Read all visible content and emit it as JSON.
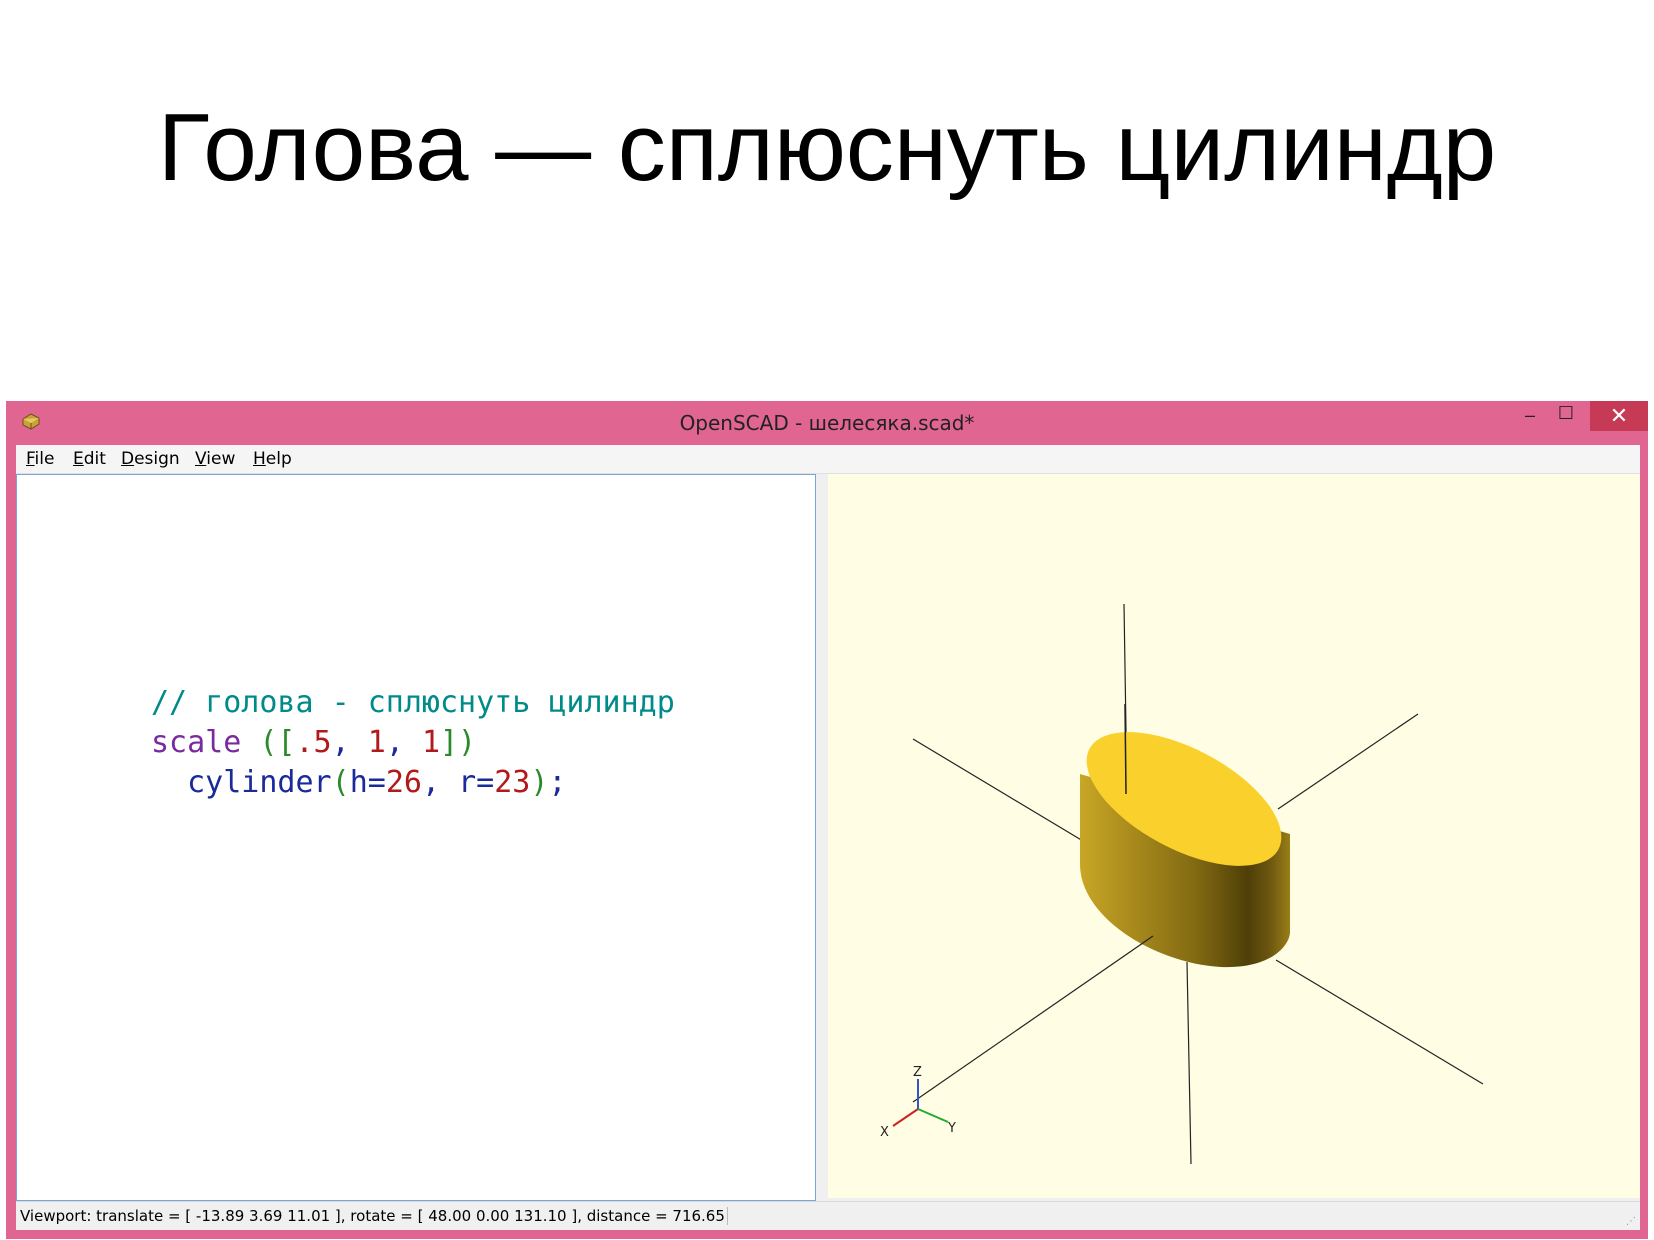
{
  "slide": {
    "title": "Голова — сплюснуть цилиндр"
  },
  "window": {
    "title": "OpenSCAD - шелесяка.scad*",
    "controls": {
      "minimize": "–",
      "maximize": "☐",
      "close": "✕"
    },
    "app_icon": "openscad-logo-icon"
  },
  "menu": {
    "items": [
      {
        "mnemonic": "F",
        "rest": "ile"
      },
      {
        "mnemonic": "E",
        "rest": "dit"
      },
      {
        "mnemonic": "D",
        "rest": "esign"
      },
      {
        "mnemonic": "V",
        "rest": "iew"
      },
      {
        "mnemonic": "H",
        "rest": "elp"
      }
    ]
  },
  "editor": {
    "line1": {
      "comment": "// голова - сплюснуть цилиндр"
    },
    "line2": {
      "keyword": "scale",
      "space": " ",
      "open": "([",
      "n1": ".5",
      "sep1": ", ",
      "n2": "1",
      "sep2": ", ",
      "n3": "1",
      "close": "])"
    },
    "line3": {
      "indent": "  ",
      "module": "cylinder",
      "open": "(",
      "p1": "h=",
      "v1": "26",
      "sep": ", ",
      "p2": "r=",
      "v2": "23",
      "close": ")",
      "end": ";"
    }
  },
  "viewer": {
    "background": "#fffee4",
    "model_color": "#f9d02c",
    "axes_labels": {
      "z": "Z",
      "x": "X",
      "y": "Y"
    }
  },
  "status": {
    "text": "Viewport: translate = [ -13.89 3.69 11.01 ], rotate = [ 48.00 0.00 131.10 ], distance = 716.65"
  },
  "colors": {
    "titlebar": "#e06590",
    "close_button": "#c73a55"
  }
}
